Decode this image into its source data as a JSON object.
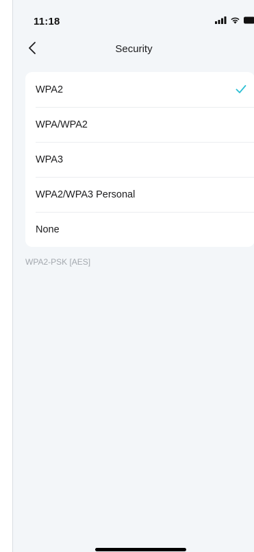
{
  "status_bar": {
    "time": "11:18",
    "icons": [
      "cellular-signal-icon",
      "wifi-icon",
      "battery-icon"
    ]
  },
  "nav": {
    "back_icon": "chevron-left-icon",
    "title": "Security"
  },
  "options": {
    "items": [
      {
        "label": "WPA2",
        "selected": true
      },
      {
        "label": "WPA/WPA2",
        "selected": false
      },
      {
        "label": "WPA3",
        "selected": false
      },
      {
        "label": "WPA2/WPA3 Personal",
        "selected": false
      },
      {
        "label": "None",
        "selected": false
      }
    ],
    "check_icon": "checkmark-icon",
    "accent_color": "#2bbfd4"
  },
  "footnote": "WPA2-PSK [AES]",
  "colors": {
    "background": "#f3f6f9",
    "card": "#ffffff",
    "text": "#1c1c1e",
    "secondary_text": "#a3a8ae"
  }
}
